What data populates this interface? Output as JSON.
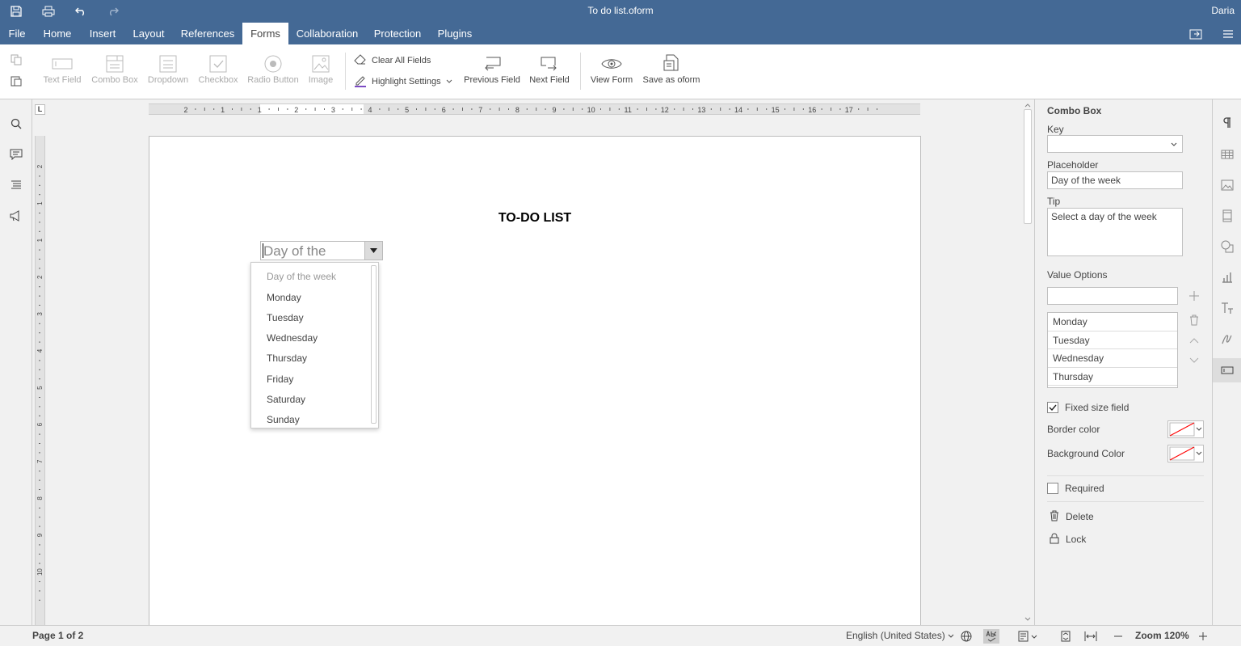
{
  "titlebar": {
    "document_title": "To do list.oform",
    "user_name": "Daria",
    "brand_color": "#446995"
  },
  "menu": {
    "tabs": [
      "File",
      "Home",
      "Insert",
      "Layout",
      "References",
      "Forms",
      "Collaboration",
      "Protection",
      "Plugins"
    ],
    "active_tab": "Forms"
  },
  "toolbar": {
    "text_field": "Text Field",
    "combo_box": "Combo Box",
    "dropdown": "Dropdown",
    "checkbox": "Checkbox",
    "radio_button": "Radio Button",
    "image": "Image",
    "clear_all_fields": "Clear All Fields",
    "highlight_settings": "Highlight Settings",
    "previous_field": "Previous Field",
    "next_field": "Next Field",
    "view_form": "View Form",
    "save_as_oform": "Save as oform"
  },
  "ruler": {
    "corner_label": "L",
    "h_labels": [
      "2",
      "1",
      "1",
      "2",
      "3",
      "4",
      "5",
      "6",
      "7",
      "8",
      "9",
      "10",
      "11",
      "12",
      "13",
      "14",
      "15",
      "16",
      "17"
    ],
    "v_labels": [
      "2",
      "1",
      "1",
      "2",
      "3",
      "4",
      "5",
      "6",
      "7",
      "8",
      "9",
      "10"
    ]
  },
  "document": {
    "heading": "TO-DO LIST",
    "combo_value": "Day of the",
    "dropdown_options": [
      "Day of the week",
      "Monday",
      "Tuesday",
      "Wednesday",
      "Thursday",
      "Friday",
      "Saturday",
      "Sunday"
    ]
  },
  "settings": {
    "section_title": "Combo Box",
    "key_label": "Key",
    "key_value": "",
    "placeholder_label": "Placeholder",
    "placeholder_value": "Day of the week",
    "tip_label": "Tip",
    "tip_value": "Select a day of the week",
    "value_options_label": "Value Options",
    "value_options_input": "",
    "value_options": [
      "Monday",
      "Tuesday",
      "Wednesday",
      "Thursday"
    ],
    "fixed_size_label": "Fixed size field",
    "fixed_size_checked": true,
    "border_color_label": "Border color",
    "background_color_label": "Background Color",
    "required_label": "Required",
    "required_checked": false,
    "delete_label": "Delete",
    "lock_label": "Lock"
  },
  "status": {
    "page_info": "Page 1 of 2",
    "language": "English (United States)",
    "zoom": "Zoom 120%"
  }
}
